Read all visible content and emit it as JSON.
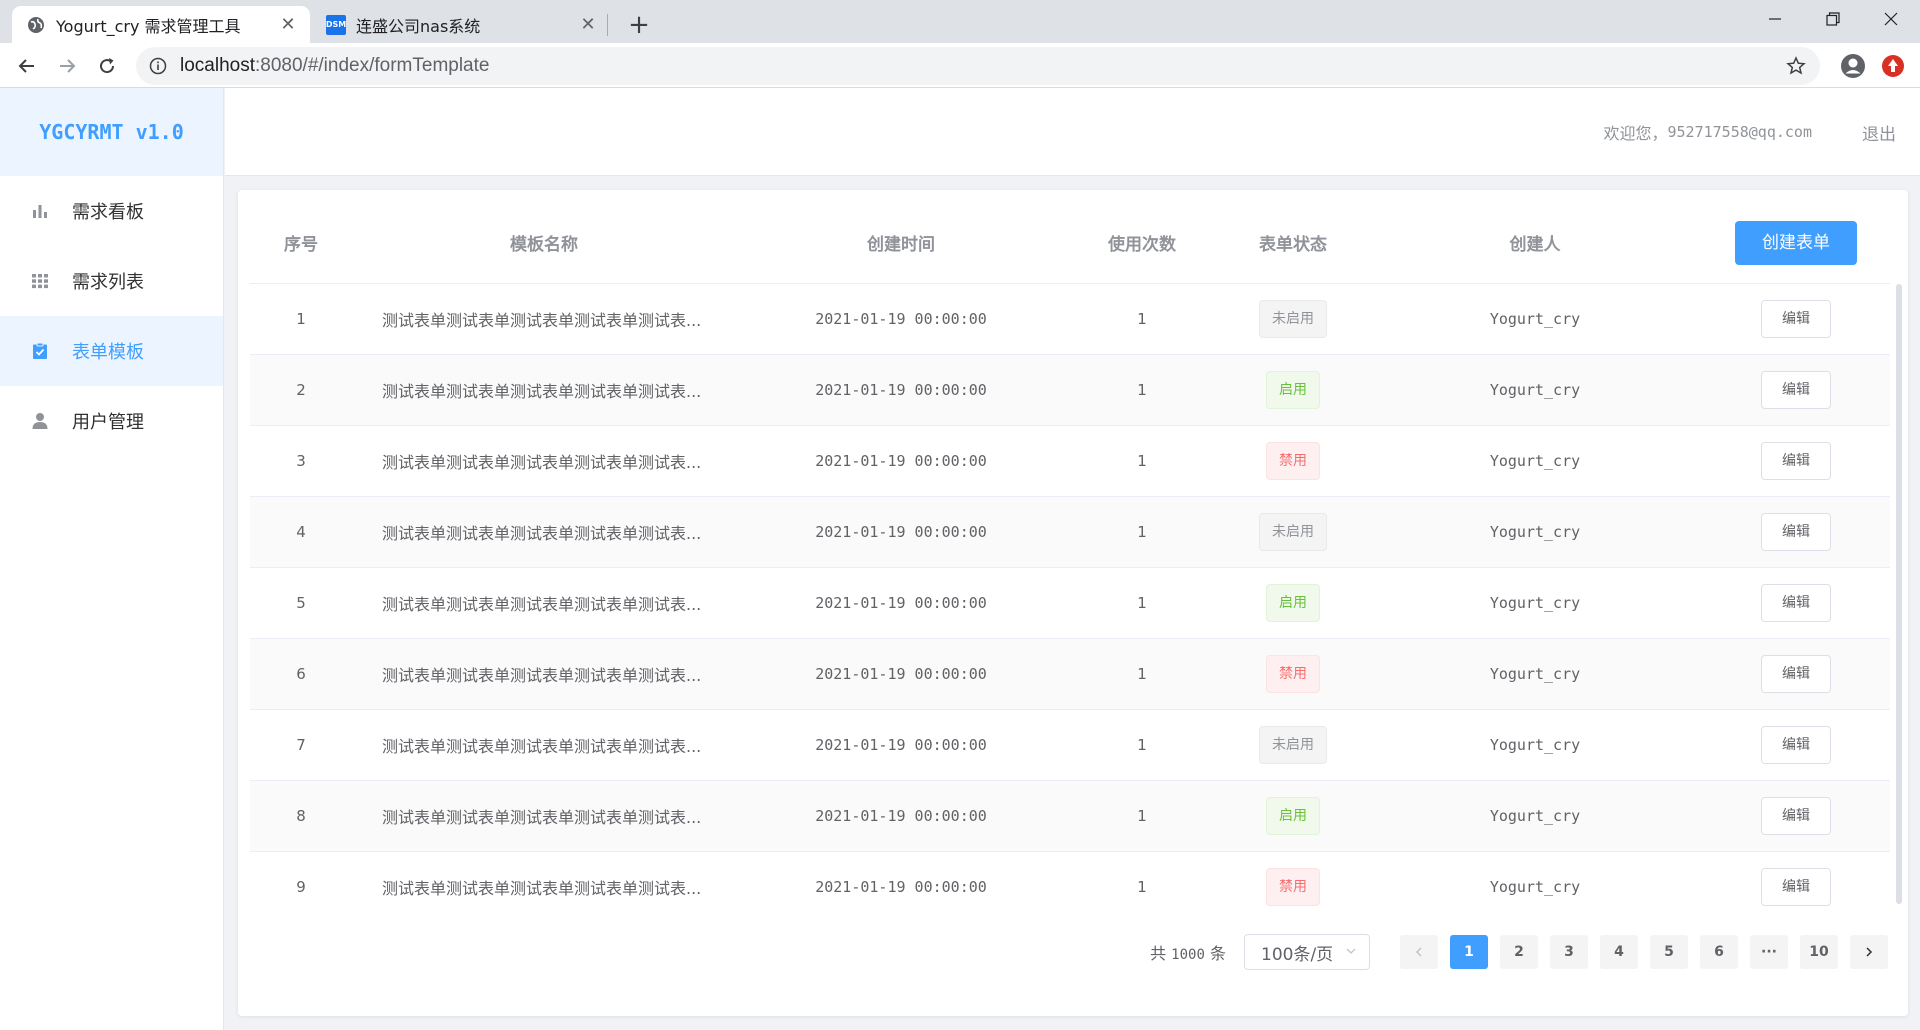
{
  "browser": {
    "tabs": [
      {
        "title": "Yogurt_cry 需求管理工具",
        "icon": "globe-icon",
        "active": true
      },
      {
        "title": "连盛公司nas系统",
        "icon": "dsm-icon",
        "active": false
      }
    ],
    "dsm_icon_text": "DSM",
    "url_host": "localhost",
    "url_path": ":8080/#/index/formTemplate"
  },
  "app": {
    "logo": "YGCYRMT v1.0",
    "menu": [
      {
        "label": "需求看板",
        "icon": "bar-chart-icon",
        "active": false
      },
      {
        "label": "需求列表",
        "icon": "grid-icon",
        "active": false
      },
      {
        "label": "表单模板",
        "icon": "clipboard-check-icon",
        "active": true
      },
      {
        "label": "用户管理",
        "icon": "user-icon",
        "active": false
      }
    ],
    "header": {
      "welcome": "欢迎您，",
      "email": "952717558@qq.com",
      "logout": "退出"
    }
  },
  "table": {
    "columns": [
      "序号",
      "模板名称",
      "创建时间",
      "使用次数",
      "表单状态",
      "创建人"
    ],
    "create_button": "创建表单",
    "edit_label": "编辑",
    "rows": [
      {
        "idx": "1",
        "name": "测试表单测试表单测试表单测试表单测试表...",
        "time": "2021-01-19 00:00:00",
        "count": "1",
        "status": "未启用",
        "status_type": "unused",
        "creator": "Yogurt_cry"
      },
      {
        "idx": "2",
        "name": "测试表单测试表单测试表单测试表单测试表...",
        "time": "2021-01-19 00:00:00",
        "count": "1",
        "status": "启用",
        "status_type": "on",
        "creator": "Yogurt_cry"
      },
      {
        "idx": "3",
        "name": "测试表单测试表单测试表单测试表单测试表...",
        "time": "2021-01-19 00:00:00",
        "count": "1",
        "status": "禁用",
        "status_type": "off",
        "creator": "Yogurt_cry"
      },
      {
        "idx": "4",
        "name": "测试表单测试表单测试表单测试表单测试表...",
        "time": "2021-01-19 00:00:00",
        "count": "1",
        "status": "未启用",
        "status_type": "unused",
        "creator": "Yogurt_cry"
      },
      {
        "idx": "5",
        "name": "测试表单测试表单测试表单测试表单测试表...",
        "time": "2021-01-19 00:00:00",
        "count": "1",
        "status": "启用",
        "status_type": "on",
        "creator": "Yogurt_cry"
      },
      {
        "idx": "6",
        "name": "测试表单测试表单测试表单测试表单测试表...",
        "time": "2021-01-19 00:00:00",
        "count": "1",
        "status": "禁用",
        "status_type": "off",
        "creator": "Yogurt_cry"
      },
      {
        "idx": "7",
        "name": "测试表单测试表单测试表单测试表单测试表...",
        "time": "2021-01-19 00:00:00",
        "count": "1",
        "status": "未启用",
        "status_type": "unused",
        "creator": "Yogurt_cry"
      },
      {
        "idx": "8",
        "name": "测试表单测试表单测试表单测试表单测试表...",
        "time": "2021-01-19 00:00:00",
        "count": "1",
        "status": "启用",
        "status_type": "on",
        "creator": "Yogurt_cry"
      },
      {
        "idx": "9",
        "name": "测试表单测试表单测试表单测试表单测试表...",
        "time": "2021-01-19 00:00:00",
        "count": "1",
        "status": "禁用",
        "status_type": "off",
        "creator": "Yogurt_cry"
      }
    ]
  },
  "pagination": {
    "total_prefix": "共",
    "total": "1000",
    "total_suffix": "条",
    "page_size": "100条/页",
    "pages": [
      "1",
      "2",
      "3",
      "4",
      "5",
      "6",
      "···",
      "10"
    ],
    "current": "1"
  }
}
